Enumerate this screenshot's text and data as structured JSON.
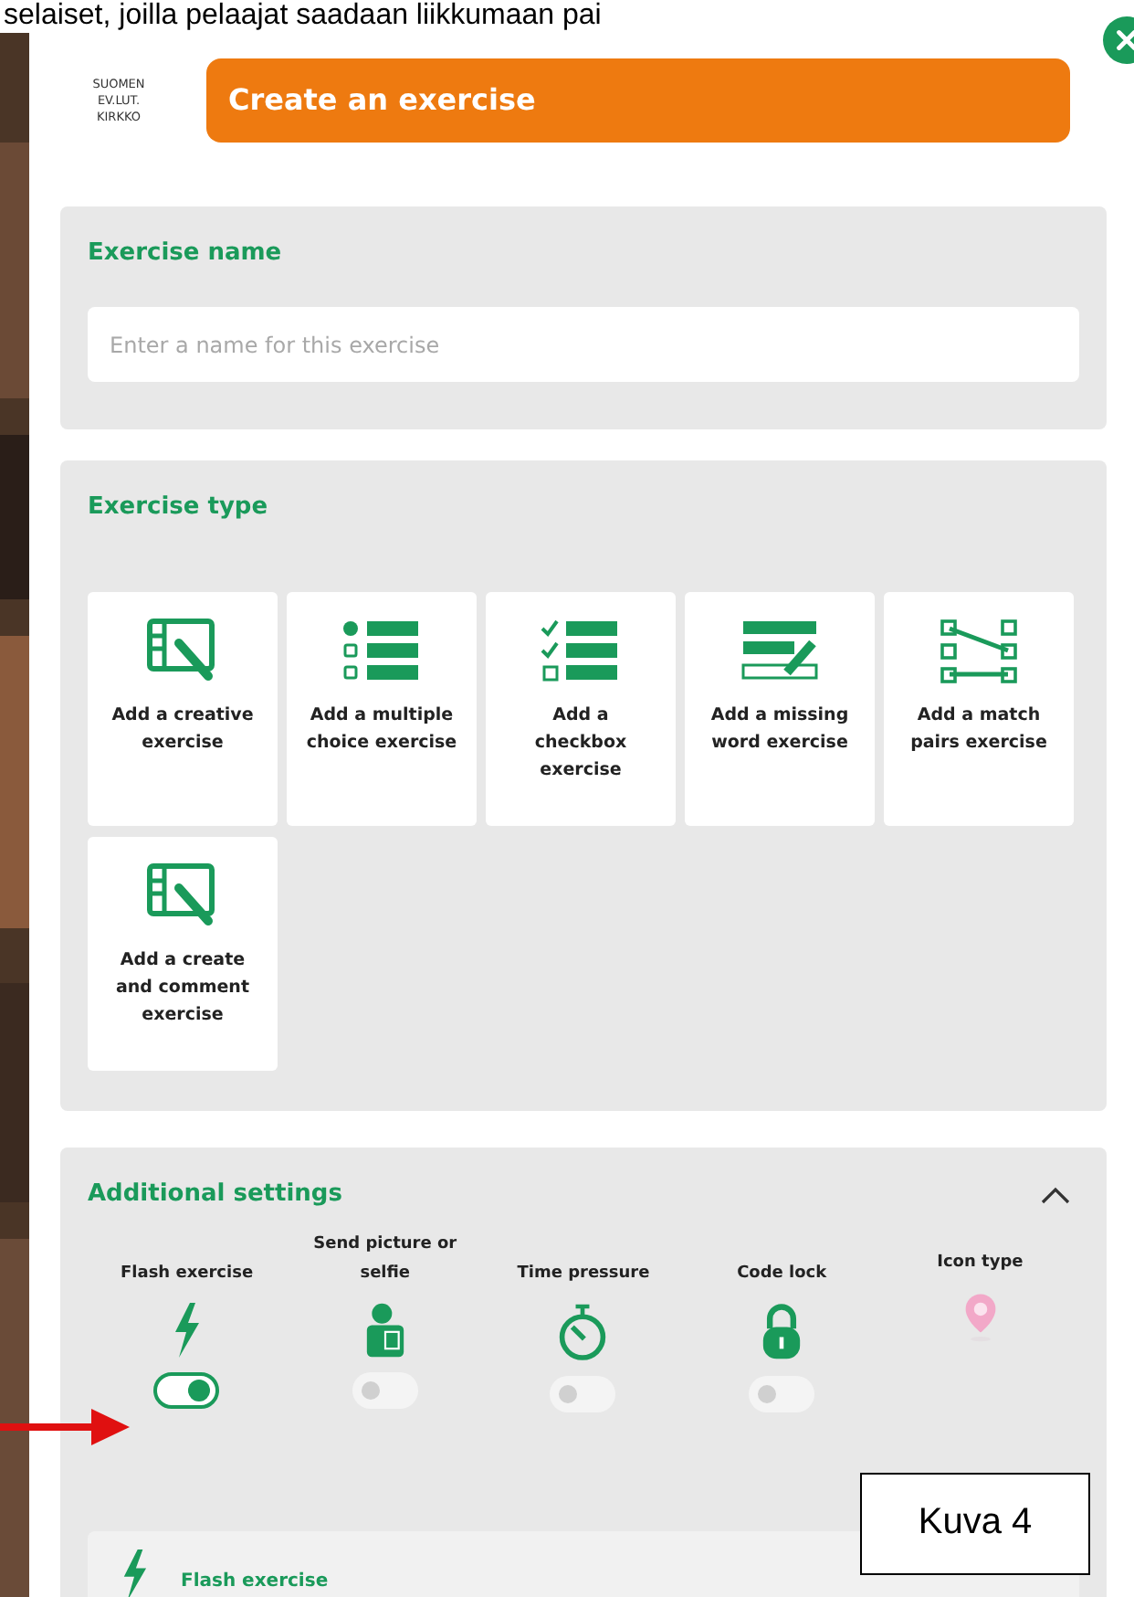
{
  "caption_top": "selaiset, joilla pelaajat saadaan liikkumaan pai",
  "logo": [
    "SUOMEN",
    "EV.LUT.",
    "KIRKKO"
  ],
  "header": {
    "title": "Create an exercise"
  },
  "exercise_name": {
    "label": "Exercise name",
    "placeholder": "Enter a name for this exercise"
  },
  "exercise_type": {
    "label": "Exercise type",
    "options": [
      {
        "kind": "creative",
        "label": "Add a creative exercise"
      },
      {
        "kind": "multiple_choice",
        "label": "Add a multiple choice exercise"
      },
      {
        "kind": "checkbox",
        "label": "Add a checkbox exercise"
      },
      {
        "kind": "missing_word",
        "label": "Add a missing word exercise"
      },
      {
        "kind": "match_pairs",
        "label": "Add a match pairs exercise"
      },
      {
        "kind": "creative",
        "label": "Add a create and comment exercise"
      }
    ]
  },
  "additional_settings": {
    "label": "Additional settings",
    "expanded": true,
    "settings": [
      {
        "kind": "flash",
        "label": "Flash exercise",
        "on": true
      },
      {
        "kind": "picture",
        "label": "Send picture or selfie",
        "on": false
      },
      {
        "kind": "timer",
        "label": "Time pressure",
        "on": false
      },
      {
        "kind": "lock",
        "label": "Code lock",
        "on": false
      },
      {
        "kind": "icon_type",
        "label": "Icon type"
      }
    ]
  },
  "flash_panel": {
    "title": "Flash exercise"
  },
  "figure_caption": "Kuva 4"
}
